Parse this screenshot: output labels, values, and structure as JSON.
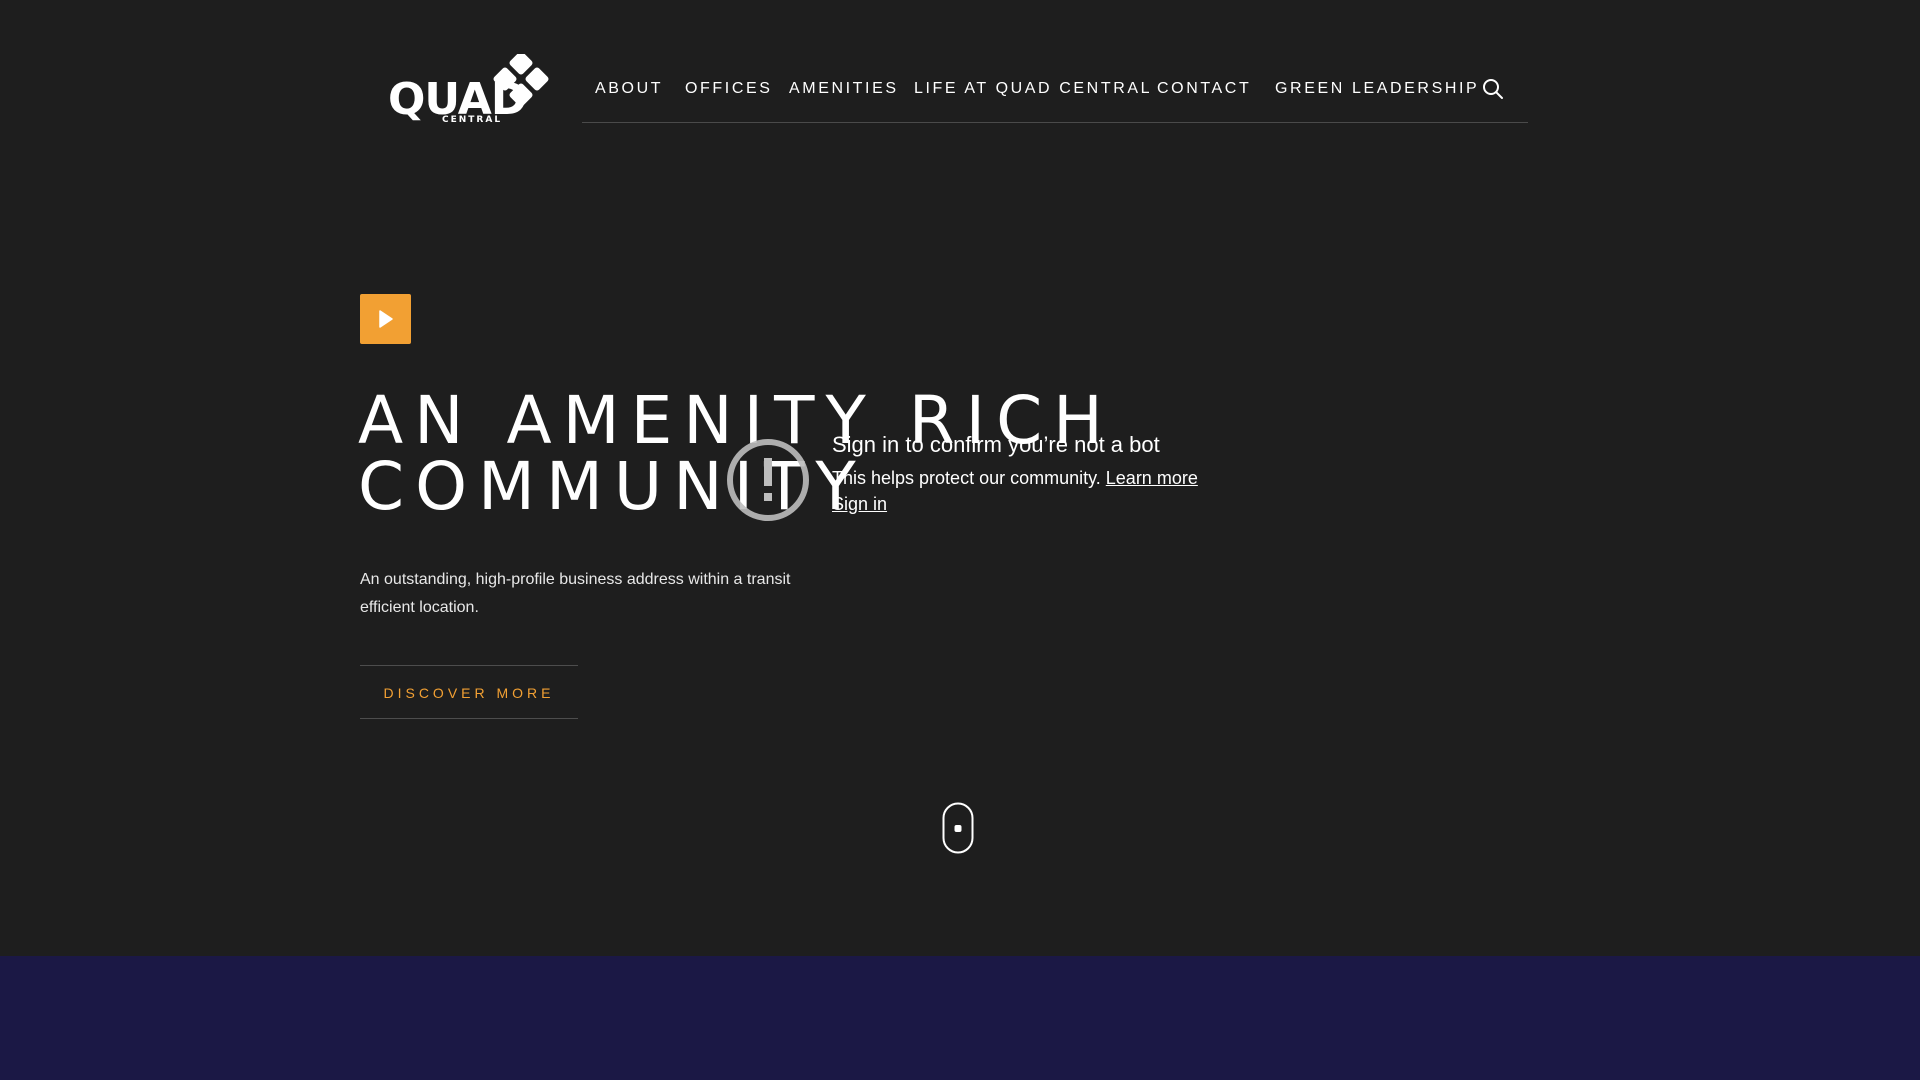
{
  "brand": {
    "logo_word": "QUAD",
    "logo_sub": "CENTRAL",
    "accent_color": "#f2a033",
    "background_color": "#1e1e1e",
    "band_color": "#1b1845"
  },
  "nav": {
    "items": [
      {
        "label": "ABOUT"
      },
      {
        "label": "OFFICES"
      },
      {
        "label": "AMENITIES"
      },
      {
        "label": "LIFE AT QUAD CENTRAL"
      },
      {
        "label": "CONTACT"
      },
      {
        "label": "GREEN LEADERSHIP"
      }
    ],
    "search_icon": "search-icon"
  },
  "hero": {
    "play_icon": "play-icon",
    "title_line1": "AN AMENITY RICH",
    "title_line2": "COMMUNITY",
    "description": "An outstanding, high-profile business address within a transit efficient location.",
    "cta_label": "DISCOVER MORE",
    "scroll_icon": "mouse-scroll-icon"
  },
  "bot_check": {
    "icon": "alert-icon",
    "title": "Sign in to confirm you’re not a bot",
    "text": "This helps protect our community.",
    "learn_more": "Learn more",
    "sign_in": "Sign in"
  }
}
